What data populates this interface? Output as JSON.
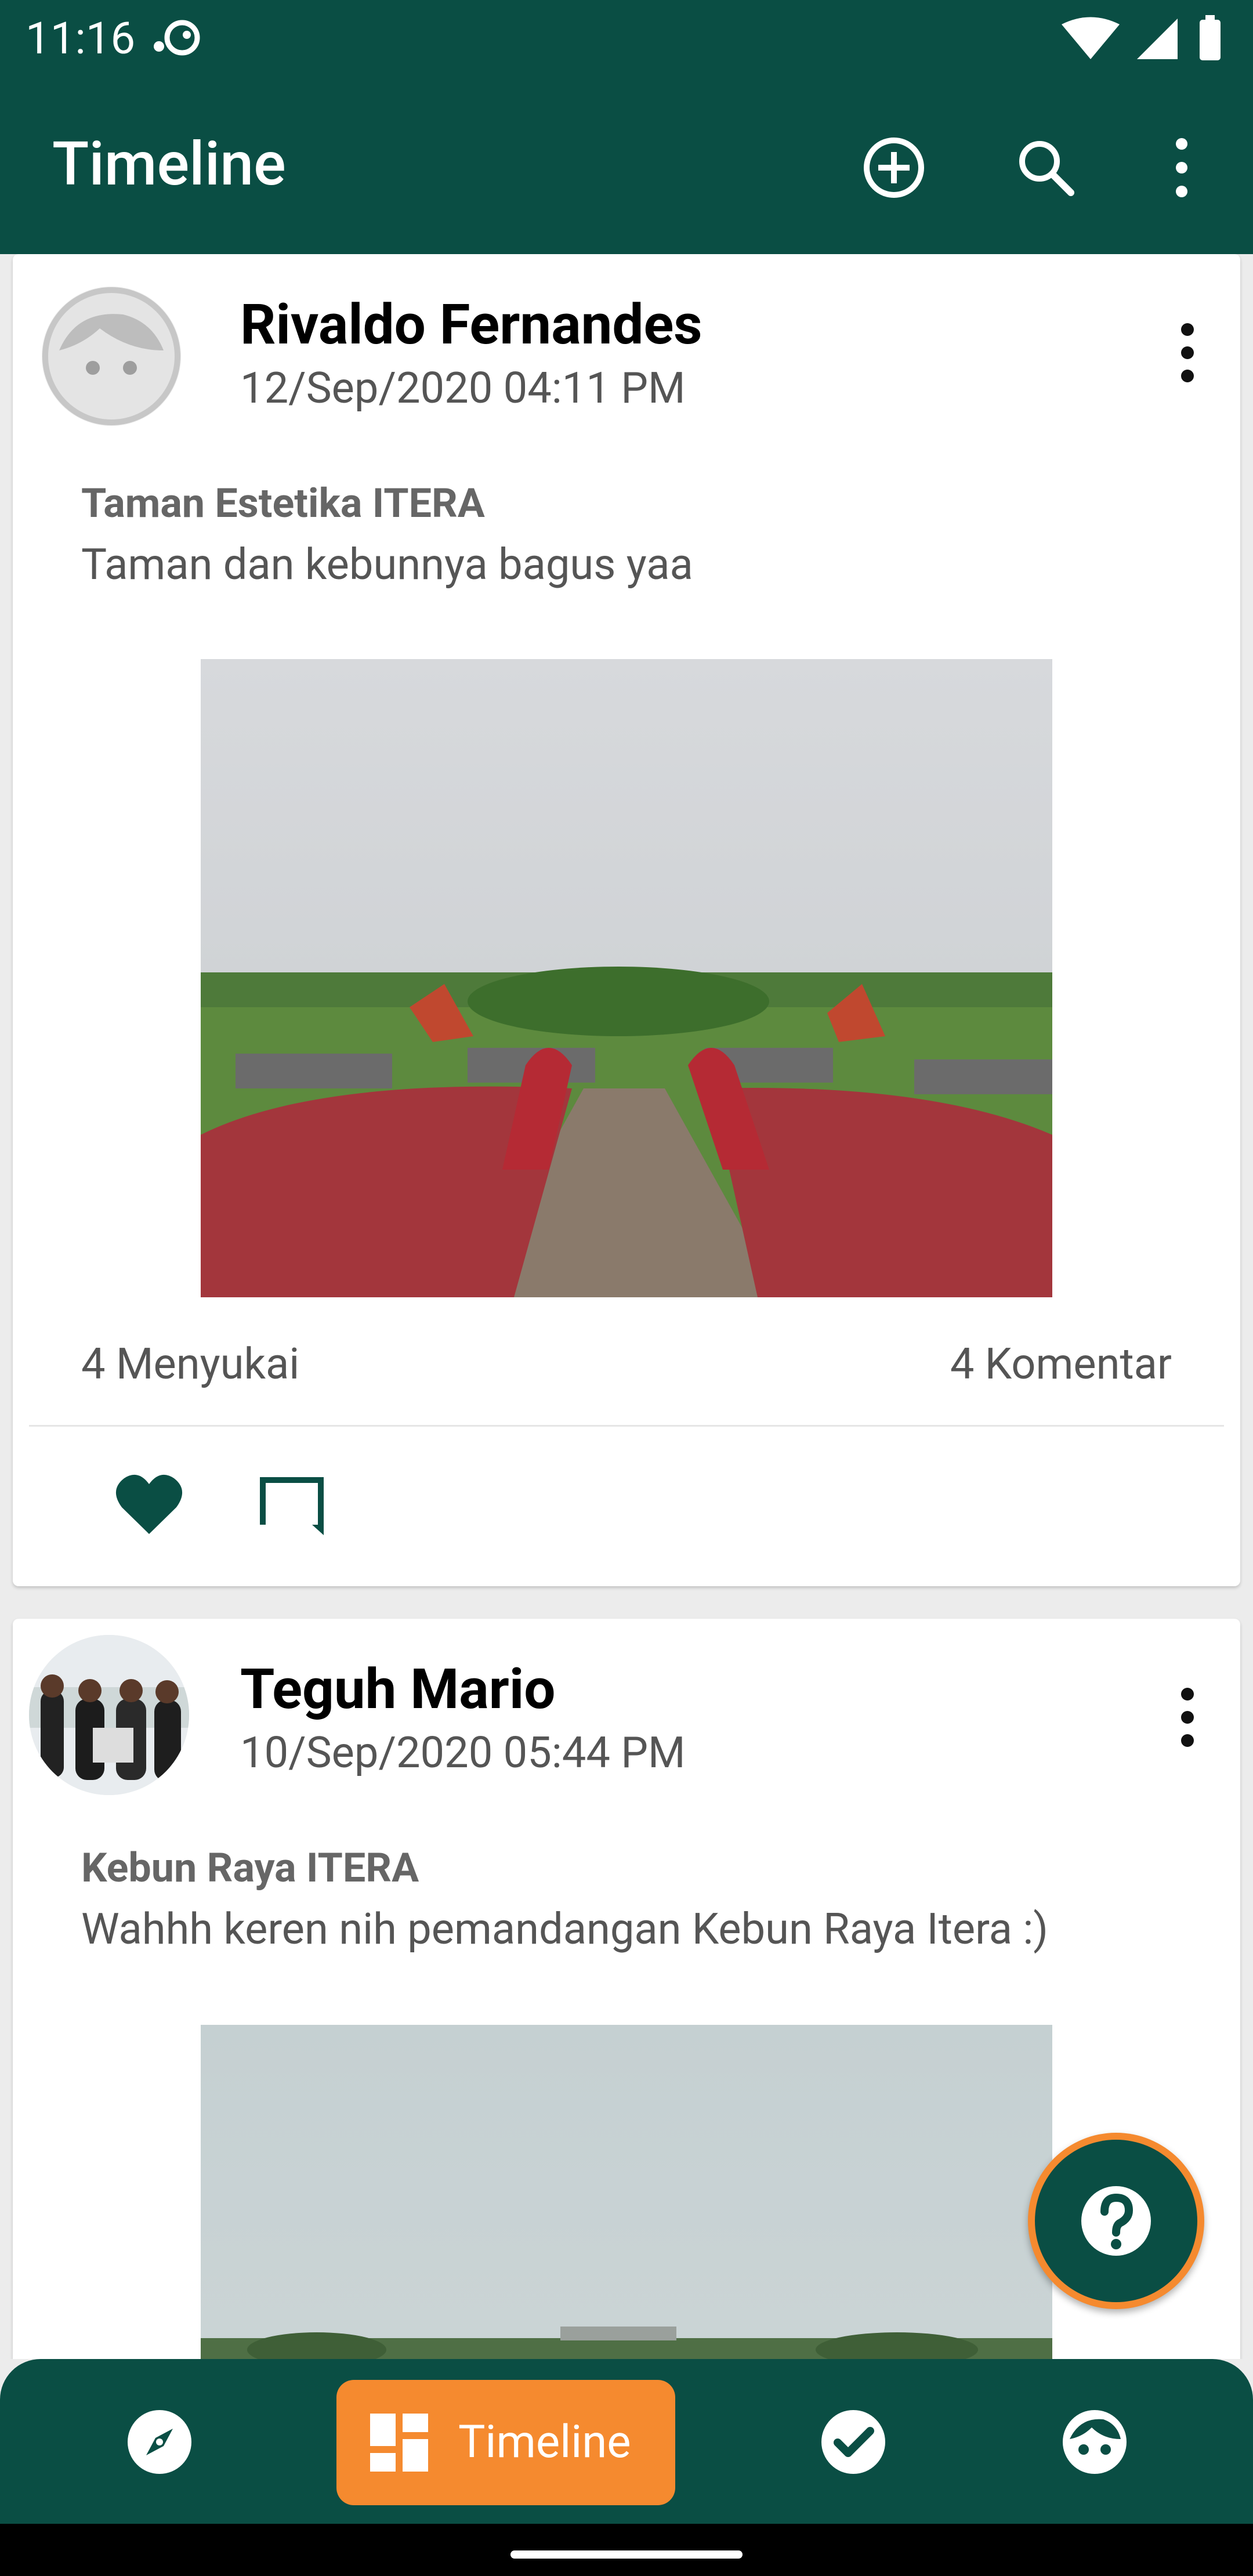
{
  "status_bar": {
    "time": "11:16"
  },
  "app_bar": {
    "title": "Timeline",
    "icons": [
      "add-circle-icon",
      "search-icon",
      "more-vert-icon"
    ]
  },
  "colors": {
    "primary": "#0a4e44",
    "accent": "#f58a2f",
    "like": "#0a4e44"
  },
  "posts": [
    {
      "author": "Rivaldo Fernandes",
      "date": "12/Sep/2020 04:11 PM",
      "title": "Taman Estetika ITERA",
      "caption": "Taman dan kebunnya bagus yaa",
      "likes": "4 Menyukai",
      "comments": "4 Komentar"
    },
    {
      "author": "Teguh Mario",
      "date": "10/Sep/2020 05:44 PM",
      "title": "Kebun Raya ITERA",
      "caption": "Wahhh keren nih pemandangan Kebun Raya Itera :)"
    }
  ],
  "fab": {
    "icon": "help-icon"
  },
  "bottom_nav": {
    "items": [
      {
        "icon": "explore-icon"
      },
      {
        "icon": "dashboard-icon",
        "label": "Timeline",
        "active": true
      },
      {
        "icon": "check-circle-icon"
      },
      {
        "icon": "face-icon"
      }
    ]
  }
}
